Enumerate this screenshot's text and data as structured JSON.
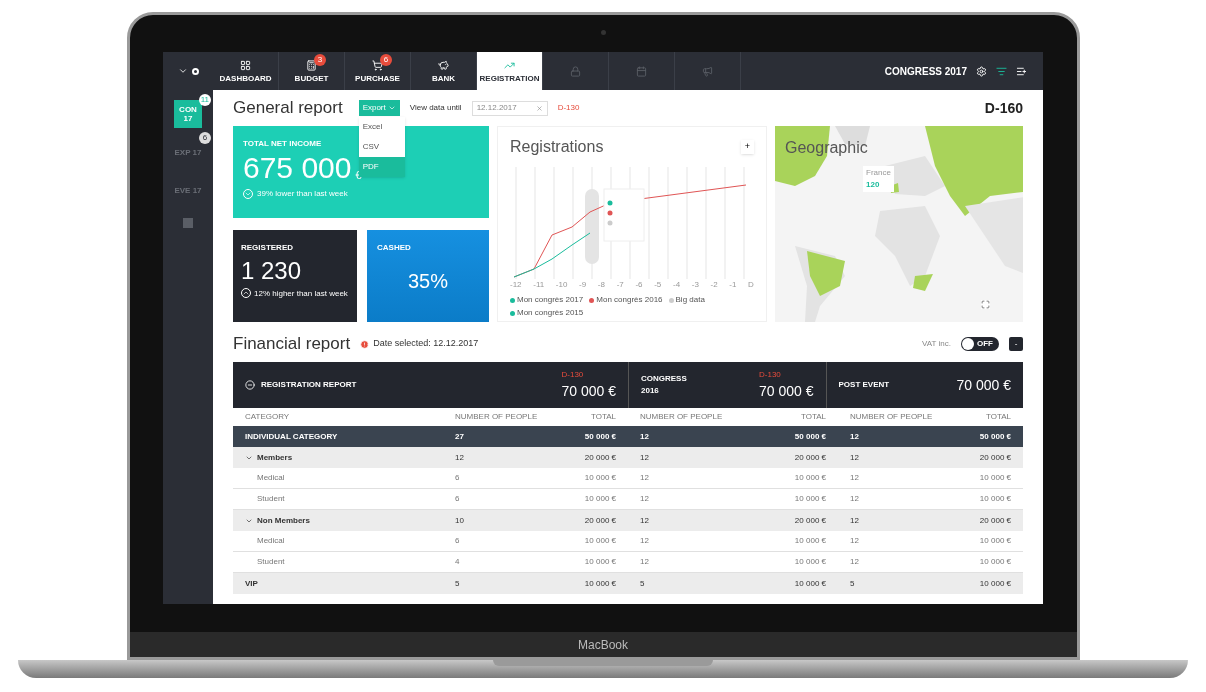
{
  "laptop": {
    "label": "MacBook"
  },
  "topbar": {
    "event": "CONGRESS 2017"
  },
  "tabs": [
    {
      "label": "DASHBOARD",
      "selected": false,
      "disabled": false
    },
    {
      "label": "BUDGET",
      "badge": "3",
      "selected": false,
      "disabled": false
    },
    {
      "label": "PURCHASE",
      "badge": "6",
      "selected": false,
      "disabled": false
    },
    {
      "label": "BANK",
      "selected": false,
      "disabled": false
    },
    {
      "label": "REGISTRATION",
      "selected": true,
      "disabled": false
    },
    {
      "selected": false,
      "disabled": true
    },
    {
      "selected": false,
      "disabled": true
    },
    {
      "selected": false,
      "disabled": true
    }
  ],
  "sidebar": [
    {
      "label": "CON 17",
      "badge": "11",
      "selected": true
    },
    {
      "label": "EXP 17",
      "badge": "6",
      "selected": false
    },
    {
      "label": "EVE 17",
      "selected": false
    }
  ],
  "general": {
    "title": "General report",
    "export": "Export",
    "export_items": [
      {
        "label": "Excel",
        "selected": false
      },
      {
        "label": "CSV",
        "selected": false
      },
      {
        "label": "PDF",
        "selected": true
      }
    ],
    "view_label": "View data until",
    "date": "12.12.2017",
    "countdown_small": "D-130",
    "countdown": "D-160"
  },
  "income": {
    "label": "TOTAL NET INCOME",
    "value": "675 000",
    "unit": "€",
    "note": "39% lower than last week"
  },
  "registered": {
    "label": "REGISTERED",
    "value": "1 230",
    "note": "12% higher than last week"
  },
  "cashed": {
    "label": "CASHED",
    "value": "35%"
  },
  "registrations": {
    "title": "Registrations",
    "add": "+",
    "x_labels": [
      "-12",
      "-11",
      "-10",
      "-9",
      "-8",
      "-7",
      "-6",
      "-5",
      "-4",
      "-3",
      "-2",
      "-1",
      "D"
    ],
    "legend": [
      {
        "label": "Mon congrès 2017",
        "color": "#1abc9c"
      },
      {
        "label": "Mon congrès 2016",
        "color": "#e05555"
      },
      {
        "label": "Big data",
        "color": "#cccccc"
      },
      {
        "label": "Mon congrès 2015",
        "color": "#1abc9c"
      }
    ]
  },
  "geographic": {
    "title": "Geographic",
    "tooltip_country": "France",
    "tooltip_value": "120"
  },
  "financial": {
    "title": "Financial report",
    "date_note": "Date selected: 12.12.2017",
    "vat_label": "VAT inc.",
    "vat_state": "OFF",
    "vat_on": false,
    "collapse": "-"
  },
  "report_header": [
    {
      "title": "REGISTRATION REPORT",
      "tag": "D-130",
      "amount": "70 000 €"
    },
    {
      "title": "CONGRESS 2016",
      "tag": "D-130",
      "amount": "70 000 €"
    },
    {
      "title": "POST EVENT",
      "amount": "70 000 €"
    }
  ],
  "columns": [
    "CATEGORY",
    "NUMBER OF PEOPLE",
    "TOTAL",
    "NUMBER OF PEOPLE",
    "TOTAL",
    "NUMBER OF PEOPLE",
    "TOTAL"
  ],
  "rows": [
    {
      "kind": "group",
      "cells": [
        "INDIVIDUAL CATEGORY",
        "27",
        "50 000 €",
        "12",
        "50 000 €",
        "12",
        "50 000 €"
      ]
    },
    {
      "kind": "section",
      "expanded": true,
      "cells": [
        "Members",
        "12",
        "20 000 €",
        "12",
        "20 000 €",
        "12",
        "20 000 €"
      ]
    },
    {
      "kind": "item",
      "cells": [
        "Medical",
        "6",
        "10 000 €",
        "12",
        "10 000 €",
        "12",
        "10 000 €"
      ]
    },
    {
      "kind": "item",
      "cells": [
        "Student",
        "6",
        "10 000 €",
        "12",
        "10 000 €",
        "12",
        "10 000 €"
      ]
    },
    {
      "kind": "section",
      "expanded": true,
      "cells": [
        "Non Members",
        "10",
        "20 000 €",
        "12",
        "20 000 €",
        "12",
        "20 000 €"
      ]
    },
    {
      "kind": "item",
      "cells": [
        "Medical",
        "6",
        "10 000 €",
        "12",
        "10 000 €",
        "12",
        "10 000 €"
      ]
    },
    {
      "kind": "item",
      "cells": [
        "Student",
        "4",
        "10 000 €",
        "12",
        "10 000 €",
        "12",
        "10 000 €"
      ]
    },
    {
      "kind": "subsection",
      "cells": [
        "VIP",
        "5",
        "10 000 €",
        "5",
        "10 000 €",
        "5",
        "10 000 €"
      ]
    }
  ]
}
